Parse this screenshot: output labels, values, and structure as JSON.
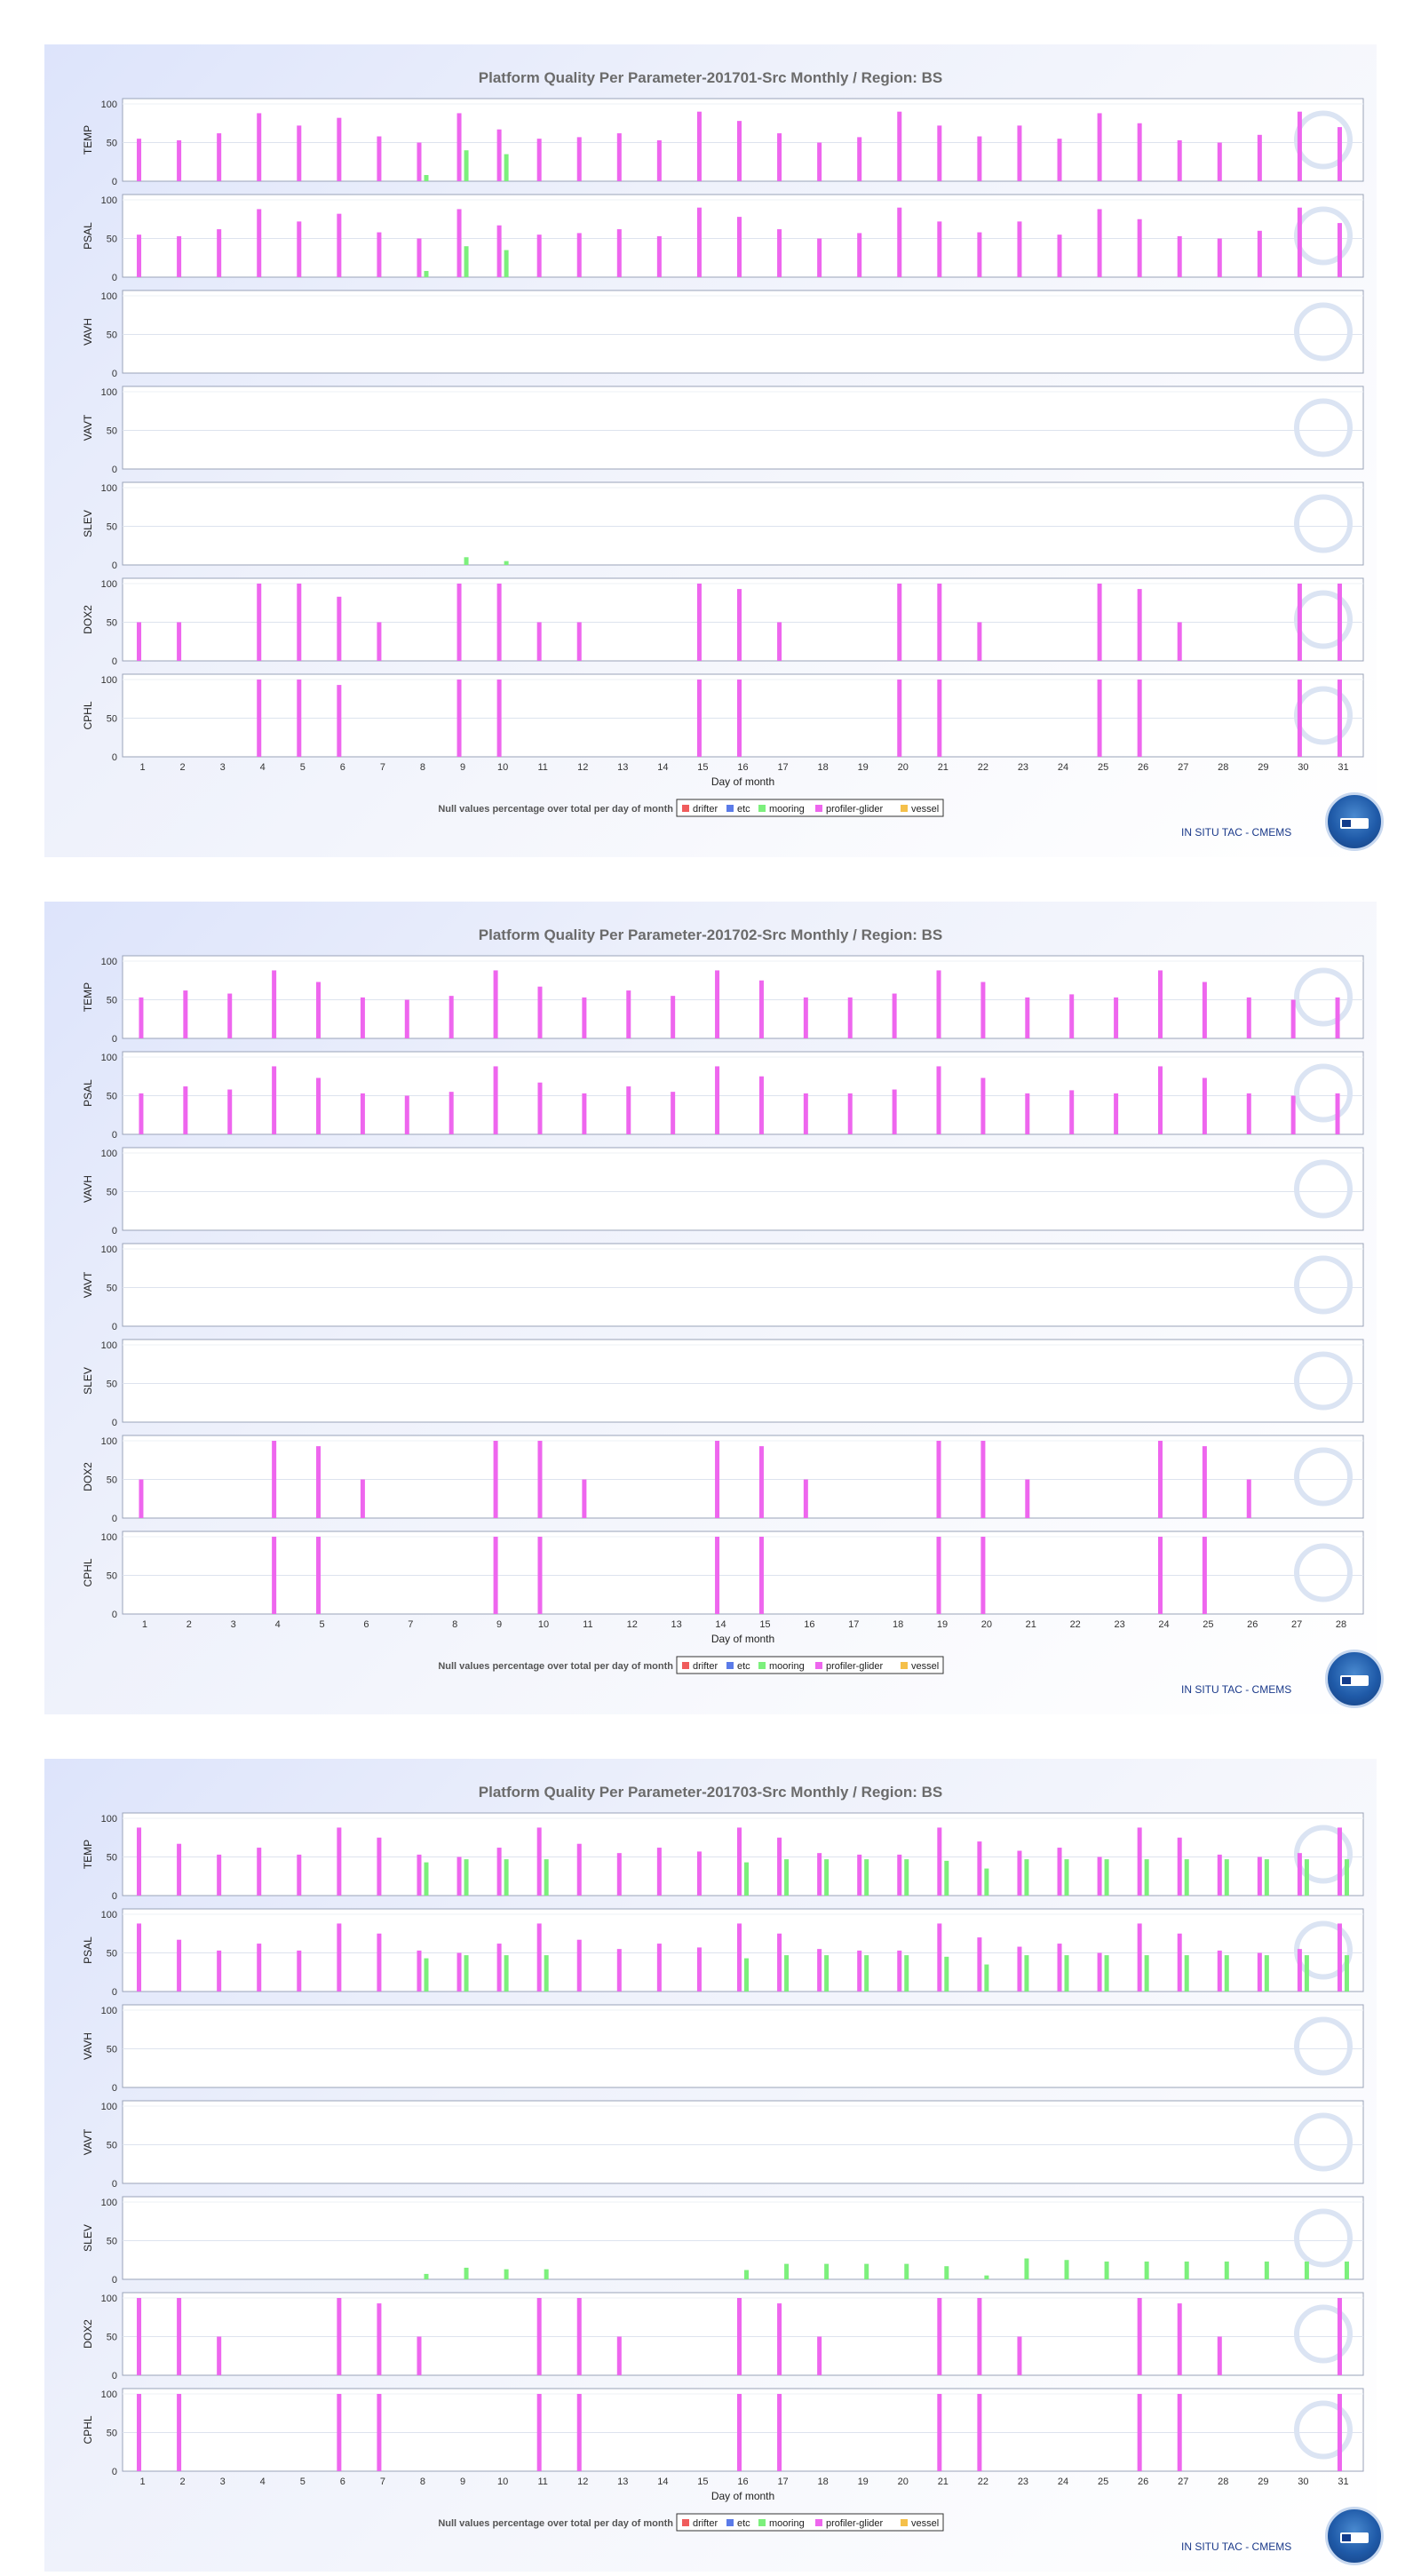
{
  "colors": {
    "drifter": "#f05c5c",
    "etc": "#5b7be8",
    "mooring": "#7cf07c",
    "profiler_glider": "#ee66ee",
    "vessel": "#f5c04a"
  },
  "shared": {
    "xlabel": "Day of month",
    "footer_note": "Null values percentage over total per day of month",
    "tac_label": "IN SITU TAC - CMEMS",
    "legend": [
      "drifter",
      "etc",
      "mooring",
      "profiler-glider",
      "vessel"
    ],
    "yticks": [
      "100",
      "50",
      "0"
    ]
  },
  "chart_data": [
    {
      "type": "bar",
      "title": "Platform Quality Per Parameter-201701-Src Monthly / Region: BS",
      "days": 31,
      "ylim": [
        0,
        100
      ],
      "panels": [
        {
          "name": "TEMP",
          "series": {
            "profiler-glider": [
              55,
              53,
              62,
              88,
              72,
              82,
              58,
              50,
              88,
              67,
              55,
              57,
              62,
              53,
              90,
              78,
              62,
              50,
              57,
              90,
              72,
              58,
              72,
              55,
              88,
              75,
              53,
              50,
              60,
              90,
              70
            ],
            "mooring": [
              0,
              0,
              0,
              0,
              0,
              0,
              0,
              8,
              40,
              35,
              0,
              0,
              0,
              0,
              0,
              0,
              0,
              0,
              0,
              0,
              0,
              0,
              0,
              0,
              0,
              0,
              0,
              0,
              0,
              0,
              0
            ]
          }
        },
        {
          "name": "PSAL",
          "series": {
            "profiler-glider": [
              55,
              53,
              62,
              88,
              72,
              82,
              58,
              50,
              88,
              67,
              55,
              57,
              62,
              53,
              90,
              78,
              62,
              50,
              57,
              90,
              72,
              58,
              72,
              55,
              88,
              75,
              53,
              50,
              60,
              90,
              70
            ],
            "mooring": [
              0,
              0,
              0,
              0,
              0,
              0,
              0,
              8,
              40,
              35,
              0,
              0,
              0,
              0,
              0,
              0,
              0,
              0,
              0,
              0,
              0,
              0,
              0,
              0,
              0,
              0,
              0,
              0,
              0,
              0,
              0
            ]
          }
        },
        {
          "name": "VAVH",
          "series": {}
        },
        {
          "name": "VAVT",
          "series": {}
        },
        {
          "name": "SLEV",
          "series": {
            "mooring": [
              0,
              0,
              0,
              0,
              0,
              0,
              0,
              0,
              10,
              5,
              0,
              0,
              0,
              0,
              0,
              0,
              0,
              0,
              0,
              0,
              0,
              0,
              0,
              0,
              0,
              0,
              0,
              0,
              0,
              0,
              0
            ]
          }
        },
        {
          "name": "DOX2",
          "series": {
            "profiler-glider": [
              50,
              50,
              0,
              100,
              100,
              83,
              50,
              0,
              100,
              100,
              50,
              50,
              0,
              0,
              100,
              93,
              50,
              0,
              0,
              100,
              100,
              50,
              0,
              0,
              100,
              93,
              50,
              0,
              0,
              100,
              100
            ]
          }
        },
        {
          "name": "CPHL",
          "series": {
            "profiler-glider": [
              0,
              0,
              0,
              100,
              100,
              93,
              0,
              0,
              100,
              100,
              0,
              0,
              0,
              0,
              100,
              100,
              0,
              0,
              0,
              100,
              100,
              0,
              0,
              0,
              100,
              100,
              0,
              0,
              0,
              100,
              100
            ]
          }
        }
      ]
    },
    {
      "type": "bar",
      "title": "Platform Quality Per Parameter-201702-Src Monthly / Region: BS",
      "days": 28,
      "ylim": [
        0,
        100
      ],
      "panels": [
        {
          "name": "TEMP",
          "series": {
            "profiler-glider": [
              53,
              62,
              58,
              88,
              73,
              53,
              50,
              55,
              88,
              67,
              53,
              62,
              55,
              88,
              75,
              53,
              53,
              58,
              88,
              73,
              53,
              57,
              53,
              88,
              73,
              53,
              50,
              53
            ]
          }
        },
        {
          "name": "PSAL",
          "series": {
            "profiler-glider": [
              53,
              62,
              58,
              88,
              73,
              53,
              50,
              55,
              88,
              67,
              53,
              62,
              55,
              88,
              75,
              53,
              53,
              58,
              88,
              73,
              53,
              57,
              53,
              88,
              73,
              53,
              50,
              53
            ]
          }
        },
        {
          "name": "VAVH",
          "series": {}
        },
        {
          "name": "VAVT",
          "series": {}
        },
        {
          "name": "SLEV",
          "series": {}
        },
        {
          "name": "DOX2",
          "series": {
            "profiler-glider": [
              50,
              0,
              0,
              100,
              93,
              50,
              0,
              0,
              100,
              100,
              50,
              0,
              0,
              100,
              93,
              50,
              0,
              0,
              100,
              100,
              50,
              0,
              0,
              100,
              93,
              50,
              0,
              0
            ]
          }
        },
        {
          "name": "CPHL",
          "series": {
            "profiler-glider": [
              0,
              0,
              0,
              100,
              100,
              0,
              0,
              0,
              100,
              100,
              0,
              0,
              0,
              100,
              100,
              0,
              0,
              0,
              100,
              100,
              0,
              0,
              0,
              100,
              100,
              0,
              0,
              0
            ]
          }
        }
      ]
    },
    {
      "type": "bar",
      "title": "Platform Quality Per Parameter-201703-Src Monthly / Region: BS",
      "days": 31,
      "ylim": [
        0,
        100
      ],
      "panels": [
        {
          "name": "TEMP",
          "series": {
            "profiler-glider": [
              88,
              67,
              53,
              62,
              53,
              88,
              75,
              53,
              50,
              62,
              88,
              67,
              55,
              62,
              57,
              88,
              75,
              55,
              53,
              53,
              88,
              70,
              58,
              62,
              50,
              88,
              75,
              53,
              50,
              55,
              88
            ],
            "mooring": [
              0,
              0,
              0,
              0,
              0,
              0,
              0,
              43,
              47,
              47,
              47,
              0,
              0,
              0,
              0,
              43,
              47,
              47,
              47,
              47,
              45,
              35,
              47,
              47,
              47,
              47,
              47,
              47,
              47,
              47,
              47
            ]
          }
        },
        {
          "name": "PSAL",
          "series": {
            "profiler-glider": [
              88,
              67,
              53,
              62,
              53,
              88,
              75,
              53,
              50,
              62,
              88,
              67,
              55,
              62,
              57,
              88,
              75,
              55,
              53,
              53,
              88,
              70,
              58,
              62,
              50,
              88,
              75,
              53,
              50,
              55,
              88
            ],
            "mooring": [
              0,
              0,
              0,
              0,
              0,
              0,
              0,
              43,
              47,
              47,
              47,
              0,
              0,
              0,
              0,
              43,
              47,
              47,
              47,
              47,
              45,
              35,
              47,
              47,
              47,
              47,
              47,
              47,
              47,
              47,
              47
            ]
          }
        },
        {
          "name": "VAVH",
          "series": {}
        },
        {
          "name": "VAVT",
          "series": {}
        },
        {
          "name": "SLEV",
          "series": {
            "mooring": [
              0,
              0,
              0,
              0,
              0,
              0,
              0,
              7,
              15,
              13,
              13,
              0,
              0,
              0,
              0,
              12,
              20,
              20,
              20,
              20,
              17,
              5,
              27,
              25,
              23,
              23,
              23,
              23,
              23,
              23,
              23
            ]
          }
        },
        {
          "name": "DOX2",
          "series": {
            "profiler-glider": [
              100,
              100,
              50,
              0,
              0,
              100,
              93,
              50,
              0,
              0,
              100,
              100,
              50,
              0,
              0,
              100,
              93,
              50,
              0,
              0,
              100,
              100,
              50,
              0,
              0,
              100,
              93,
              50,
              0,
              0,
              100
            ]
          }
        },
        {
          "name": "CPHL",
          "series": {
            "profiler-glider": [
              100,
              100,
              0,
              0,
              0,
              100,
              100,
              0,
              0,
              0,
              100,
              100,
              0,
              0,
              0,
              100,
              100,
              0,
              0,
              0,
              100,
              100,
              0,
              0,
              0,
              100,
              100,
              0,
              0,
              0,
              100
            ]
          }
        }
      ]
    }
  ]
}
